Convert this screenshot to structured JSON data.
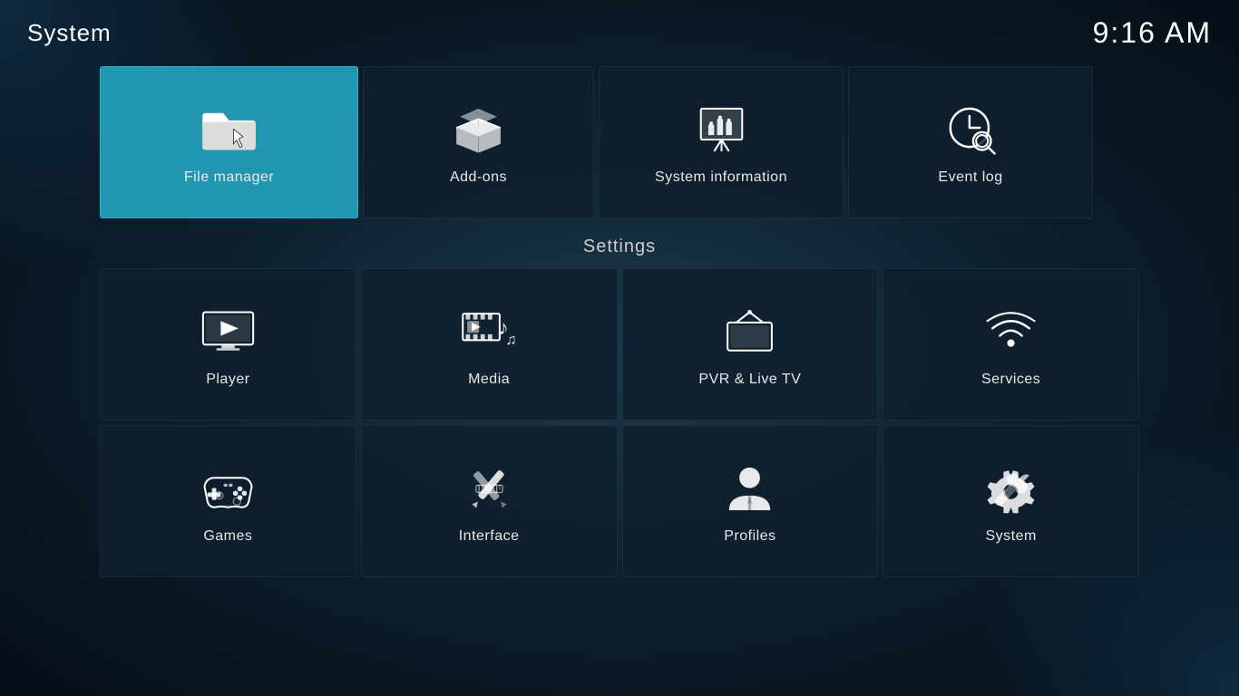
{
  "header": {
    "title": "System",
    "time": "9:16 AM"
  },
  "top_row": [
    {
      "id": "file-manager",
      "label": "File manager",
      "active": true
    },
    {
      "id": "add-ons",
      "label": "Add-ons",
      "active": false
    },
    {
      "id": "system-information",
      "label": "System information",
      "active": false
    },
    {
      "id": "event-log",
      "label": "Event log",
      "active": false
    }
  ],
  "settings_label": "Settings",
  "settings_row1": [
    {
      "id": "player",
      "label": "Player"
    },
    {
      "id": "media",
      "label": "Media"
    },
    {
      "id": "pvr-live-tv",
      "label": "PVR & Live TV"
    },
    {
      "id": "services",
      "label": "Services"
    }
  ],
  "settings_row2": [
    {
      "id": "games",
      "label": "Games"
    },
    {
      "id": "interface",
      "label": "Interface"
    },
    {
      "id": "profiles",
      "label": "Profiles"
    },
    {
      "id": "system",
      "label": "System"
    }
  ]
}
